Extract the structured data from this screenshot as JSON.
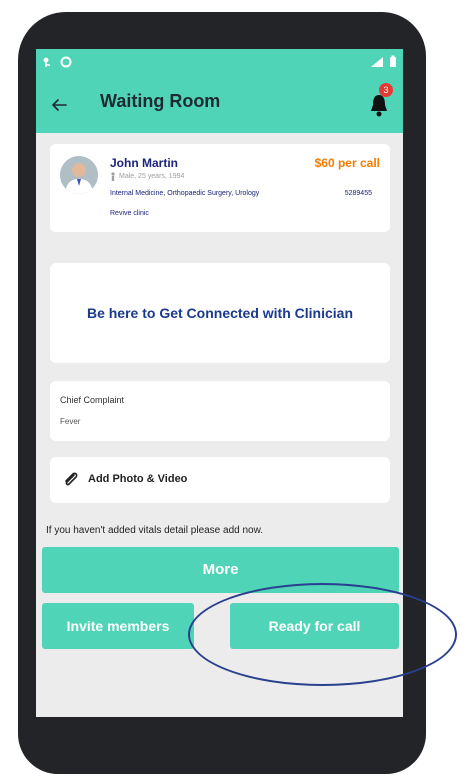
{
  "appbar": {
    "title": "Waiting Room",
    "notification_count": "3"
  },
  "doctor": {
    "name": "John Martin",
    "meta": "Male, 25 years, 1994",
    "price": "$60 per call",
    "specialties": "Internal Medicine, Orthopaedic Surgery, Urology",
    "id": "5289455",
    "clinic": "Revive clinic"
  },
  "connect": {
    "message": "Be here to Get  Connected with Clinician"
  },
  "complaint": {
    "label": "Chief Complaint",
    "value": "Fever"
  },
  "media": {
    "label": "Add Photo & Video"
  },
  "vitals": {
    "notice": "If you haven't added vitals detail please add now."
  },
  "buttons": {
    "more": "More",
    "invite": "Invite members",
    "ready": "Ready for call"
  },
  "colors": {
    "accent": "#4fd4b7",
    "price": "#f57c00",
    "navy": "#1a237e",
    "badge": "#e53935",
    "annotation": "#2a3f8f"
  }
}
